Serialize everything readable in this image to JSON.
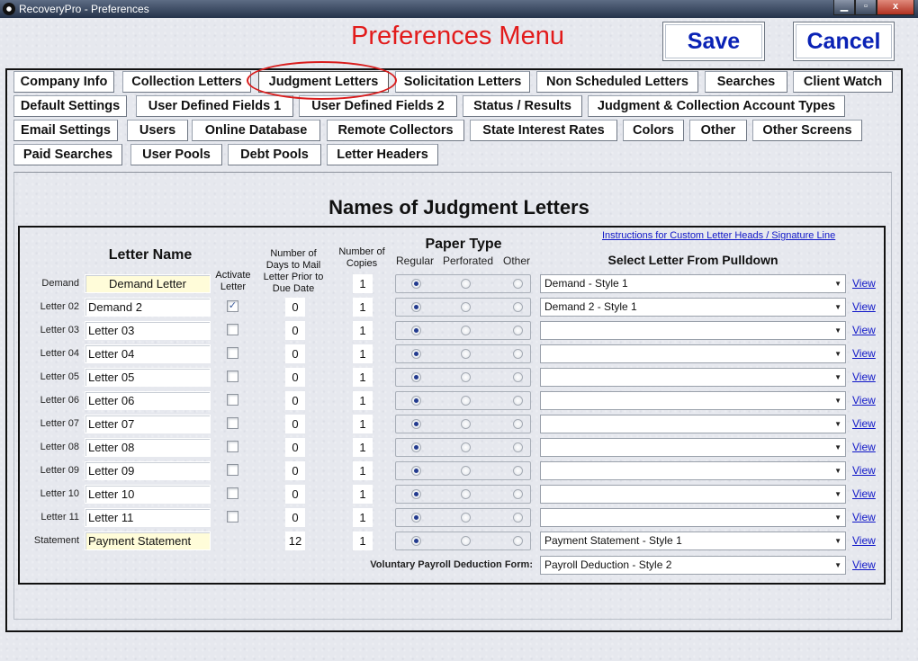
{
  "window": {
    "title": "RecoveryPro - Preferences",
    "min_glyph": "▁",
    "max_glyph": "▫",
    "close_glyph": "x"
  },
  "header": {
    "menu_title": "Preferences Menu",
    "save_label": "Save",
    "cancel_label": "Cancel",
    "accent_color": "#0a22b5",
    "title_color": "#e21b1b"
  },
  "tabs": {
    "row1": [
      "Company Info",
      "Collection Letters",
      "Judgment Letters",
      "Solicitation Letters",
      "Non Scheduled Letters",
      "Searches",
      "Client Watch"
    ],
    "row2": [
      "Default Settings",
      "User Defined Fields 1",
      "User Defined Fields 2",
      "Status / Results",
      "Judgment & Collection Account Types"
    ],
    "row3": [
      "Email Settings",
      "Users",
      "Online Database",
      "Remote Collectors",
      "State Interest Rates",
      "Colors",
      "Other",
      "Other Screens"
    ],
    "row4": [
      "Paid Searches",
      "User Pools",
      "Debt Pools",
      "Letter Headers"
    ],
    "active": "Judgment Letters"
  },
  "section": {
    "title": "Names of Judgment Letters",
    "instructions_link": "Instructions for Custom Letter Heads / Signature Line"
  },
  "columns": {
    "letter_name": "Letter Name",
    "activate_letter": "Activate Letter",
    "days_prior": "Number of Days to Mail Letter Prior to Due Date",
    "copies": "Number of Copies",
    "paper_type": "Paper Type",
    "paper_regular": "Regular",
    "paper_perforated": "Perforated",
    "paper_other": "Other",
    "select_letter": "Select Letter From Pulldown"
  },
  "rows": [
    {
      "label": "Demand",
      "name": "Demand Letter",
      "activatable": false,
      "active": false,
      "days": "",
      "copies": "1",
      "paper": "regular",
      "template": "Demand - Style 1",
      "view": "View"
    },
    {
      "label": "Letter 02",
      "name": "Demand 2",
      "activatable": true,
      "active": true,
      "days": "0",
      "copies": "1",
      "paper": "regular",
      "template": "Demand 2 - Style 1",
      "view": "View"
    },
    {
      "label": "Letter 03",
      "name": "Letter 03",
      "activatable": true,
      "active": false,
      "days": "0",
      "copies": "1",
      "paper": "regular",
      "template": "",
      "view": "View"
    },
    {
      "label": "Letter 04",
      "name": "Letter 04",
      "activatable": true,
      "active": false,
      "days": "0",
      "copies": "1",
      "paper": "regular",
      "template": "",
      "view": "View"
    },
    {
      "label": "Letter 05",
      "name": "Letter 05",
      "activatable": true,
      "active": false,
      "days": "0",
      "copies": "1",
      "paper": "regular",
      "template": "",
      "view": "View"
    },
    {
      "label": "Letter 06",
      "name": "Letter 06",
      "activatable": true,
      "active": false,
      "days": "0",
      "copies": "1",
      "paper": "regular",
      "template": "",
      "view": "View"
    },
    {
      "label": "Letter 07",
      "name": "Letter 07",
      "activatable": true,
      "active": false,
      "days": "0",
      "copies": "1",
      "paper": "regular",
      "template": "",
      "view": "View"
    },
    {
      "label": "Letter 08",
      "name": "Letter 08",
      "activatable": true,
      "active": false,
      "days": "0",
      "copies": "1",
      "paper": "regular",
      "template": "",
      "view": "View"
    },
    {
      "label": "Letter 09",
      "name": "Letter 09",
      "activatable": true,
      "active": false,
      "days": "0",
      "copies": "1",
      "paper": "regular",
      "template": "",
      "view": "View"
    },
    {
      "label": "Letter 10",
      "name": "Letter 10",
      "activatable": true,
      "active": false,
      "days": "0",
      "copies": "1",
      "paper": "regular",
      "template": "",
      "view": "View"
    },
    {
      "label": "Letter 11",
      "name": "Letter 11",
      "activatable": true,
      "active": false,
      "days": "0",
      "copies": "1",
      "paper": "regular",
      "template": "",
      "view": "View"
    },
    {
      "label": "Statement",
      "name": "Payment Statement",
      "activatable": false,
      "active": false,
      "days": "12",
      "copies": "1",
      "paper": "regular",
      "template": "Payment Statement - Style 1",
      "view": "View"
    }
  ],
  "payroll": {
    "label": "Voluntary Payroll Deduction Form:",
    "template": "Payroll Deduction - Style 2",
    "view": "View"
  },
  "icons": {
    "dropdown_arrow": "▼",
    "check": "✓"
  }
}
